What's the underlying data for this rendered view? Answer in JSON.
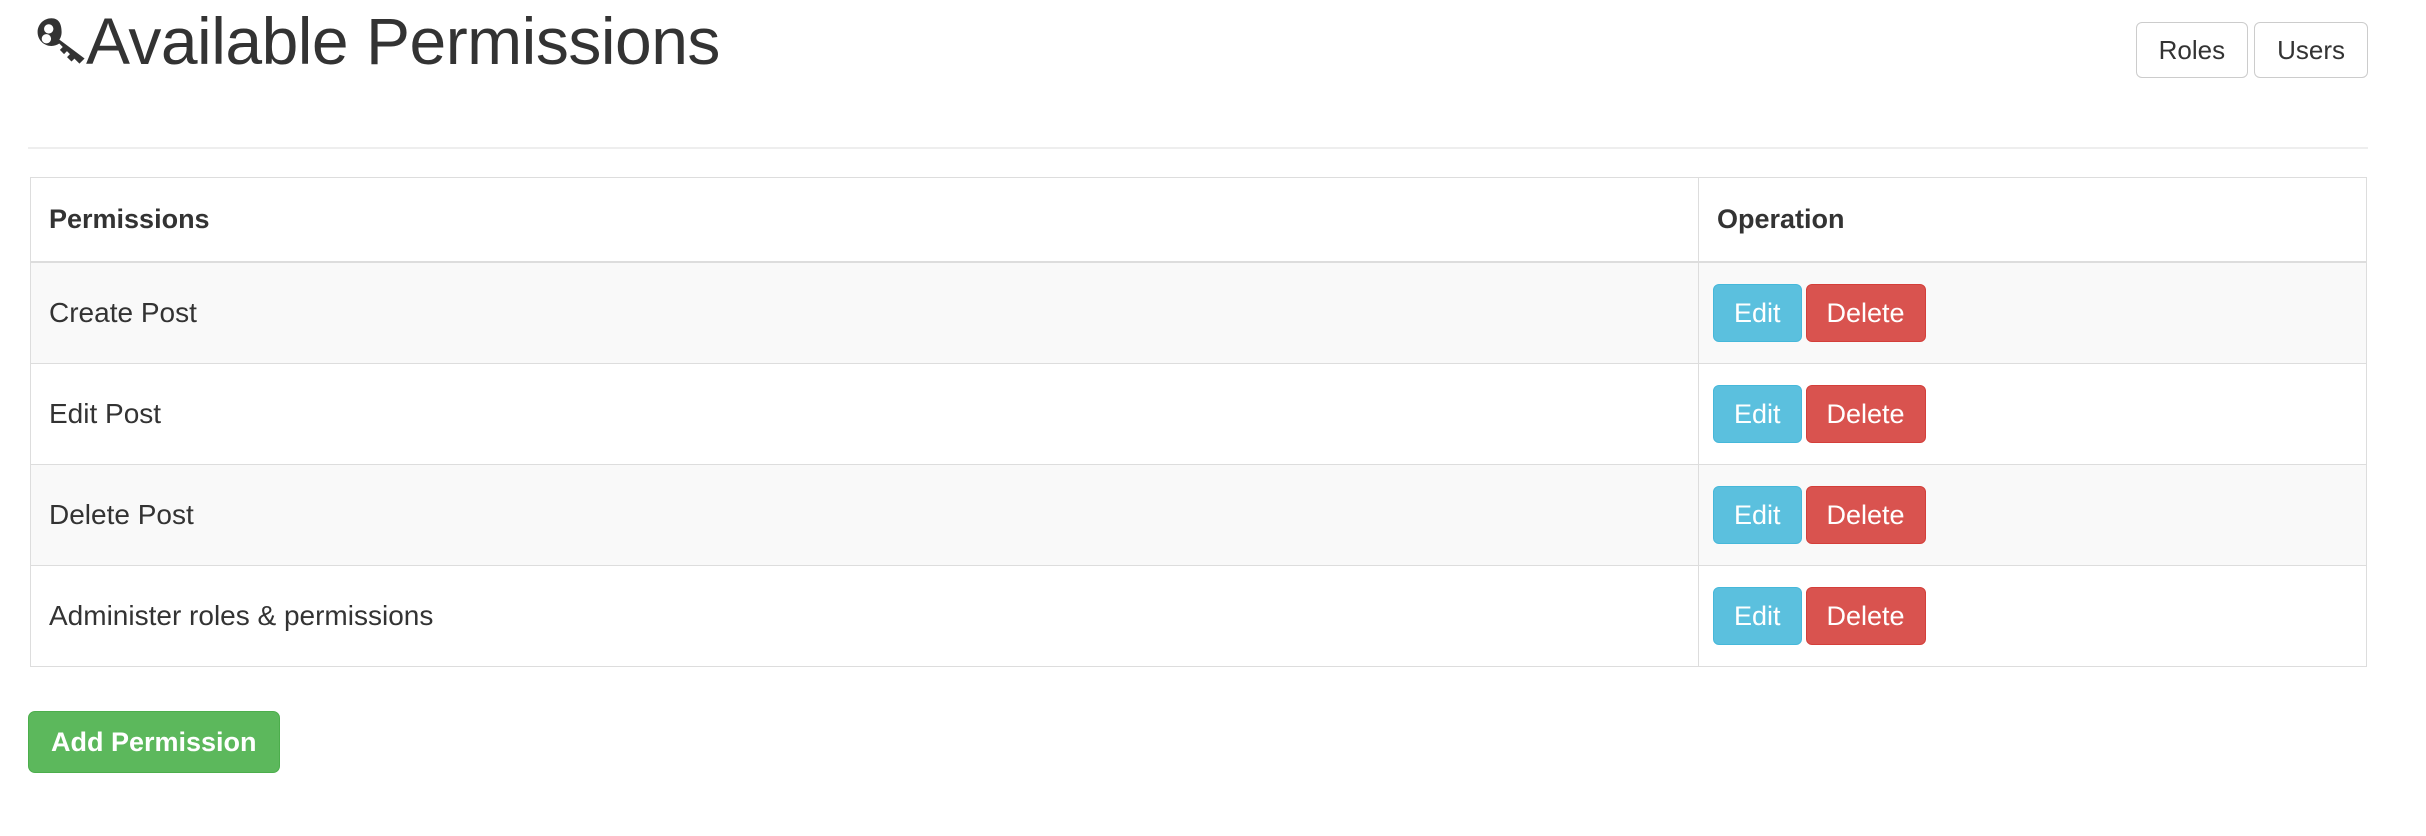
{
  "header": {
    "icon": "key-icon",
    "title": "Available Permissions",
    "actions": [
      {
        "label": "Roles",
        "name": "roles-button"
      },
      {
        "label": "Users",
        "name": "users-button"
      }
    ]
  },
  "table": {
    "columns": [
      "Permissions",
      "Operation"
    ],
    "rows": [
      {
        "permission": "Create Post",
        "edit_label": "Edit",
        "delete_label": "Delete"
      },
      {
        "permission": "Edit Post",
        "edit_label": "Edit",
        "delete_label": "Delete"
      },
      {
        "permission": "Delete Post",
        "edit_label": "Edit",
        "delete_label": "Delete"
      },
      {
        "permission": "Administer roles & permissions",
        "edit_label": "Edit",
        "delete_label": "Delete"
      }
    ]
  },
  "footer": {
    "add_label": "Add Permission"
  },
  "colors": {
    "edit": "#5bc0de",
    "delete": "#d9534f",
    "add": "#5cb85c",
    "text": "#333333",
    "border": "#dddddd",
    "stripe": "#f9f9f9"
  }
}
